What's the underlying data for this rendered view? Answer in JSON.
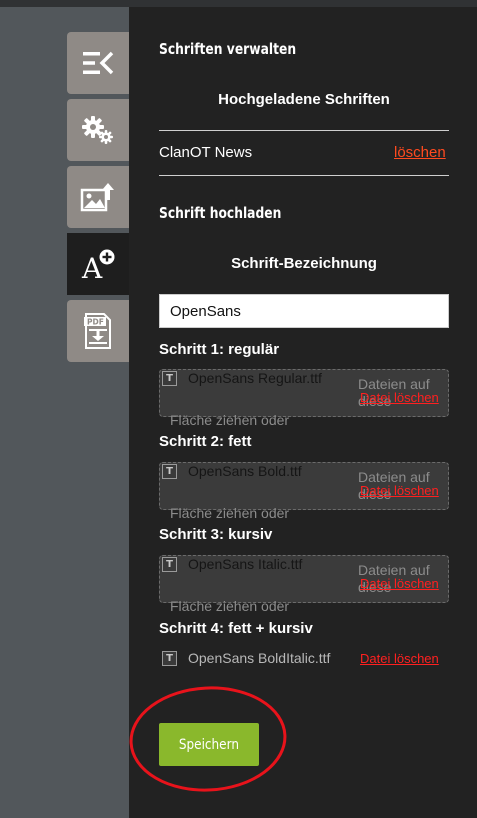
{
  "sidebar": {
    "items": [
      {
        "icon": "collapse-icon"
      },
      {
        "icon": "gears-icon"
      },
      {
        "icon": "image-upload-icon"
      },
      {
        "icon": "font-add-icon",
        "glyph": "A",
        "active": true
      },
      {
        "icon": "pdf-download-icon",
        "glyph": "PDF"
      }
    ]
  },
  "panel": {
    "title": "Schriften verwalten",
    "uploaded_heading": "Hochgeladene Schriften",
    "uploaded_fonts": [
      {
        "name": "ClanOT News",
        "delete_label": "löschen"
      }
    ],
    "upload_heading": "Schrift hochladen",
    "name_label": "Schrift-Bezeichnung",
    "name_value": "OpenSans",
    "steps": [
      {
        "label": "Schritt 1: regulär",
        "file": "OpenSans Regular.ttf",
        "delete_label": "Datei löschen",
        "hint_right": "Dateien auf",
        "hint_right2": "diese",
        "hint_left": "Fläche ziehen oder"
      },
      {
        "label": "Schritt 2: fett",
        "file": "OpenSans Bold.ttf",
        "delete_label": "Datei löschen",
        "hint_right": "Dateien auf",
        "hint_right2": "diese",
        "hint_left": "Fläche ziehen oder"
      },
      {
        "label": "Schritt 3: kursiv",
        "file": "OpenSans Italic.ttf",
        "delete_label": "Datei löschen",
        "hint_right": "Dateien auf",
        "hint_right2": "diese",
        "hint_left": "Fläche ziehen oder"
      },
      {
        "label": "Schritt 4: fett + kursiv",
        "file": "OpenSans BoldItalic.ttf",
        "delete_label": "Datei löschen"
      }
    ],
    "file_icon_glyph": "T",
    "save_label": "Speichern"
  },
  "colors": {
    "accent_green": "#8ab82c",
    "delete_link": "#ff4a1f",
    "annotation_circle": "#e8131b"
  }
}
